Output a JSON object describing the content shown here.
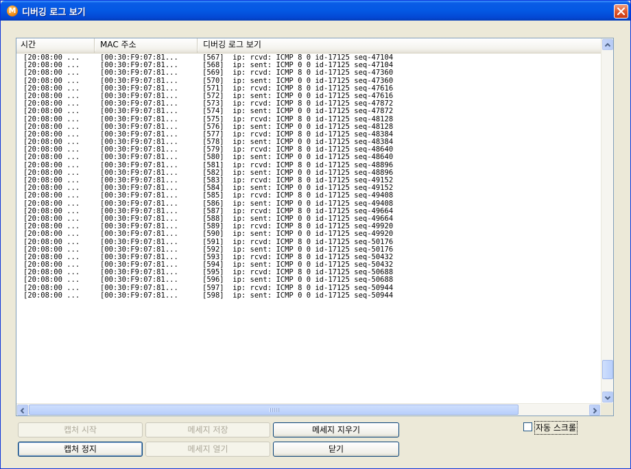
{
  "window": {
    "title": "디버깅 로그 보기",
    "app_icon_letter": "M"
  },
  "list": {
    "columns": [
      "시간",
      "MAC 주소",
      "디버깅 로그 보기"
    ],
    "rows": [
      [
        "[20:08:00 ...",
        "[00:30:F9:07:81...",
        "[567]  ip: rcvd: ICMP 8 0 id-17125 seq-47104"
      ],
      [
        "[20:08:00 ...",
        "[00:30:F9:07:81...",
        "[568]  ip: sent: ICMP 0 0 id-17125 seq-47104"
      ],
      [
        "[20:08:00 ...",
        "[00:30:F9:07:81...",
        "[569]  ip: rcvd: ICMP 8 0 id-17125 seq-47360"
      ],
      [
        "[20:08:00 ...",
        "[00:30:F9:07:81...",
        "[570]  ip: sent: ICMP 0 0 id-17125 seq-47360"
      ],
      [
        "[20:08:00 ...",
        "[00:30:F9:07:81...",
        "[571]  ip: rcvd: ICMP 8 0 id-17125 seq-47616"
      ],
      [
        "[20:08:00 ...",
        "[00:30:F9:07:81...",
        "[572]  ip: sent: ICMP 0 0 id-17125 seq-47616"
      ],
      [
        "[20:08:00 ...",
        "[00:30:F9:07:81...",
        "[573]  ip: rcvd: ICMP 8 0 id-17125 seq-47872"
      ],
      [
        "[20:08:00 ...",
        "[00:30:F9:07:81...",
        "[574]  ip: sent: ICMP 0 0 id-17125 seq-47872"
      ],
      [
        "[20:08:00 ...",
        "[00:30:F9:07:81...",
        "[575]  ip: rcvd: ICMP 8 0 id-17125 seq-48128"
      ],
      [
        "[20:08:00 ...",
        "[00:30:F9:07:81...",
        "[576]  ip: sent: ICMP 0 0 id-17125 seq-48128"
      ],
      [
        "[20:08:00 ...",
        "[00:30:F9:07:81...",
        "[577]  ip: rcvd: ICMP 8 0 id-17125 seq-48384"
      ],
      [
        "[20:08:00 ...",
        "[00:30:F9:07:81...",
        "[578]  ip: sent: ICMP 0 0 id-17125 seq-48384"
      ],
      [
        "[20:08:00 ...",
        "[00:30:F9:07:81...",
        "[579]  ip: rcvd: ICMP 8 0 id-17125 seq-48640"
      ],
      [
        "[20:08:00 ...",
        "[00:30:F9:07:81...",
        "[580]  ip: sent: ICMP 0 0 id-17125 seq-48640"
      ],
      [
        "[20:08:00 ...",
        "[00:30:F9:07:81...",
        "[581]  ip: rcvd: ICMP 8 0 id-17125 seq-48896"
      ],
      [
        "[20:08:00 ...",
        "[00:30:F9:07:81...",
        "[582]  ip: sent: ICMP 0 0 id-17125 seq-48896"
      ],
      [
        "[20:08:00 ...",
        "[00:30:F9:07:81...",
        "[583]  ip: rcvd: ICMP 8 0 id-17125 seq-49152"
      ],
      [
        "[20:08:00 ...",
        "[00:30:F9:07:81...",
        "[584]  ip: sent: ICMP 0 0 id-17125 seq-49152"
      ],
      [
        "[20:08:00 ...",
        "[00:30:F9:07:81...",
        "[585]  ip: rcvd: ICMP 8 0 id-17125 seq-49408"
      ],
      [
        "[20:08:00 ...",
        "[00:30:F9:07:81...",
        "[586]  ip: sent: ICMP 0 0 id-17125 seq-49408"
      ],
      [
        "[20:08:00 ...",
        "[00:30:F9:07:81...",
        "[587]  ip: rcvd: ICMP 8 0 id-17125 seq-49664"
      ],
      [
        "[20:08:00 ...",
        "[00:30:F9:07:81...",
        "[588]  ip: sent: ICMP 0 0 id-17125 seq-49664"
      ],
      [
        "[20:08:00 ...",
        "[00:30:F9:07:81...",
        "[589]  ip: rcvd: ICMP 8 0 id-17125 seq-49920"
      ],
      [
        "[20:08:00 ...",
        "[00:30:F9:07:81...",
        "[590]  ip: sent: ICMP 0 0 id-17125 seq-49920"
      ],
      [
        "[20:08:00 ...",
        "[00:30:F9:07:81...",
        "[591]  ip: rcvd: ICMP 8 0 id-17125 seq-50176"
      ],
      [
        "[20:08:00 ...",
        "[00:30:F9:07:81...",
        "[592]  ip: sent: ICMP 0 0 id-17125 seq-50176"
      ],
      [
        "[20:08:00 ...",
        "[00:30:F9:07:81...",
        "[593]  ip: rcvd: ICMP 8 0 id-17125 seq-50432"
      ],
      [
        "[20:08:00 ...",
        "[00:30:F9:07:81...",
        "[594]  ip: sent: ICMP 0 0 id-17125 seq-50432"
      ],
      [
        "[20:08:00 ...",
        "[00:30:F9:07:81...",
        "[595]  ip: rcvd: ICMP 8 0 id-17125 seq-50688"
      ],
      [
        "[20:08:00 ...",
        "[00:30:F9:07:81...",
        "[596]  ip: sent: ICMP 0 0 id-17125 seq-50688"
      ],
      [
        "[20:08:00 ...",
        "[00:30:F9:07:81...",
        "[597]  ip: rcvd: ICMP 8 0 id-17125 seq-50944"
      ],
      [
        "[20:08:00 ...",
        "[00:30:F9:07:81...",
        "[598]  ip: sent: ICMP 0 0 id-17125 seq-50944"
      ]
    ]
  },
  "buttons": {
    "capture_start": "캡처 시작",
    "message_save": "메세지 저장",
    "message_clear": "메세지 지우기",
    "capture_stop": "캡처 정지",
    "message_open": "메세지 열기",
    "close": "닫기"
  },
  "auto_scroll": {
    "label": "자동 스크롤",
    "checked": false
  },
  "icons": {
    "close": "close-icon",
    "scroll_up": "chevron-up-icon",
    "scroll_down": "chevron-down-icon",
    "scroll_left": "chevron-left-icon",
    "scroll_right": "chevron-right-icon"
  },
  "colors": {
    "titlebar": "#0458e3",
    "close_button": "#e0582c",
    "window_bg": "#ece9d8"
  }
}
